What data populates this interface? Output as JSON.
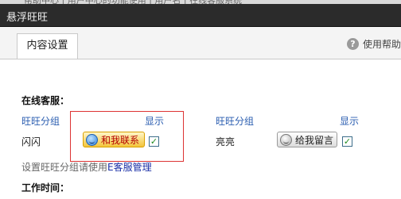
{
  "window": {
    "strip_text": "帮助中心 | 用户中心的功能使用 | 用户名 | 在线客服系统",
    "title": "悬浮旺旺"
  },
  "tabs": [
    {
      "label": "内容设置"
    }
  ],
  "help": {
    "label": "使用帮助",
    "icon": "question-circle-icon"
  },
  "online_service": {
    "section_title": "在线客服：",
    "columns": {
      "group_left": "旺旺分组",
      "show_left": "显示",
      "group_right": "旺旺分组",
      "show_right": "显示"
    },
    "rows": [
      {
        "name": "闪闪",
        "button_label": "和我联系",
        "button_style": "online",
        "show_checked": true
      },
      {
        "name": "亮亮",
        "button_label": "给我留言",
        "button_style": "offline",
        "show_checked": true
      }
    ],
    "hint_prefix": "设置旺旺分组请使用",
    "hint_link": "E客服管理"
  },
  "work_time": {
    "section_title": "工作时间："
  },
  "colors": {
    "title_bar": "#2b2b2b",
    "link_blue": "#2a5db0",
    "highlight_red": "#dd3333",
    "online_button": "#f3c53c"
  }
}
